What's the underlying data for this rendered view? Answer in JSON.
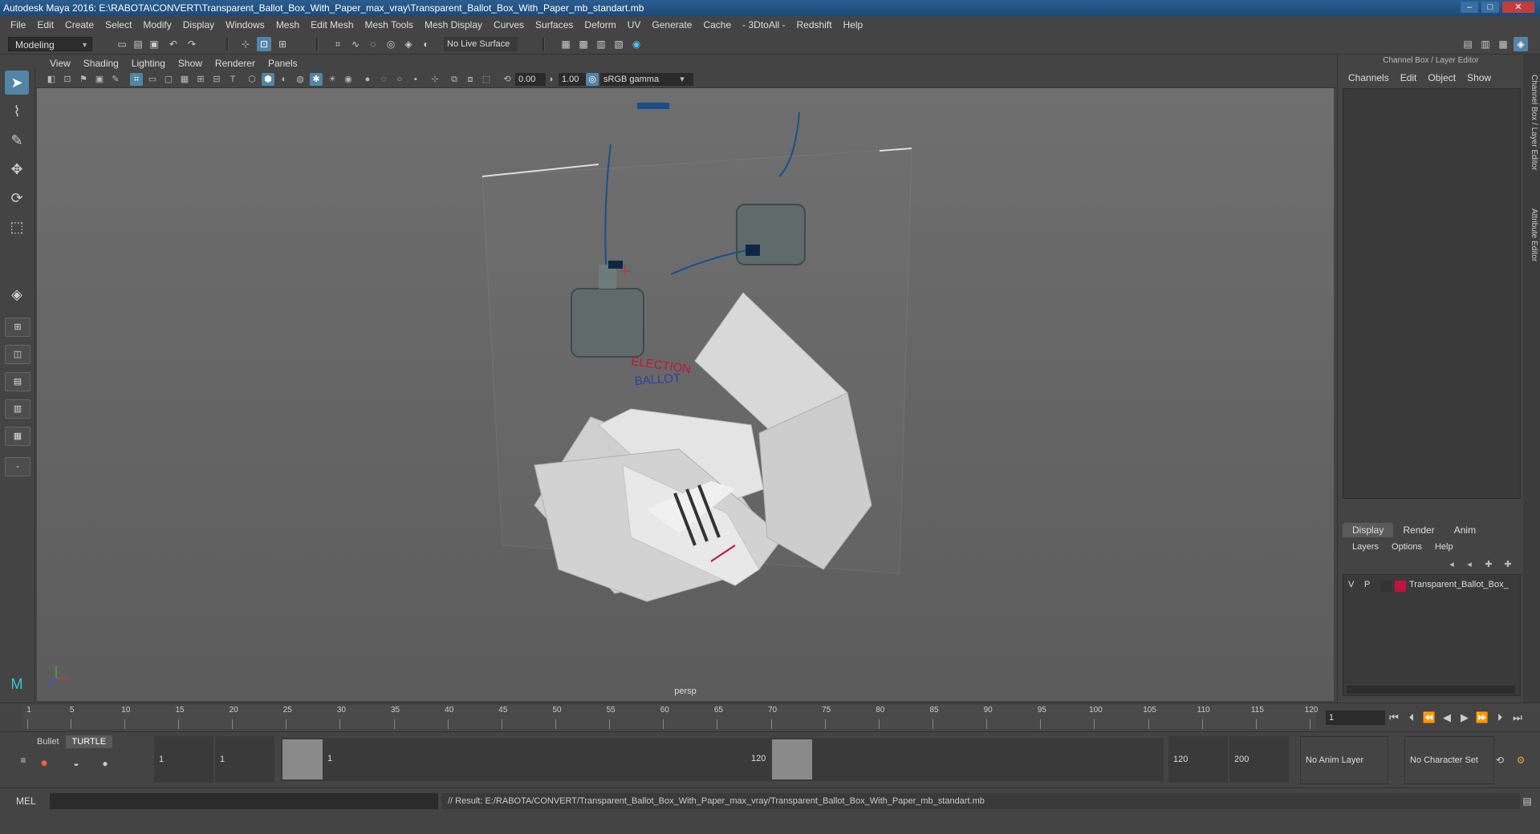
{
  "window": {
    "title": "Autodesk Maya 2016: E:\\RABOTA\\CONVERT\\Transparent_Ballot_Box_With_Paper_max_vray\\Transparent_Ballot_Box_With_Paper_mb_standart.mb"
  },
  "menu": [
    "File",
    "Edit",
    "Create",
    "Select",
    "Modify",
    "Display",
    "Windows",
    "Mesh",
    "Edit Mesh",
    "Mesh Tools",
    "Mesh Display",
    "Curves",
    "Surfaces",
    "Deform",
    "UV",
    "Generate",
    "Cache",
    "- 3DtoAll -",
    "Redshift",
    "Help"
  ],
  "toolbar": {
    "workspace": "Modeling",
    "live_surface": "No Live Surface"
  },
  "viewport_menu": [
    "View",
    "Shading",
    "Lighting",
    "Show",
    "Renderer",
    "Panels"
  ],
  "viewport_fields": {
    "exposure": "0.00",
    "gamma": "1.00",
    "color_space": "sRGB gamma"
  },
  "viewport": {
    "camera": "persp",
    "ballot_text1": "ELECTION",
    "ballot_text2": "BALLOT"
  },
  "channel_box": {
    "title": "Channel Box / Layer Editor",
    "menu": [
      "Channels",
      "Edit",
      "Object",
      "Show"
    ],
    "tabs": [
      "Display",
      "Render",
      "Anim"
    ],
    "layer_menu": [
      "Layers",
      "Options",
      "Help"
    ],
    "layer": {
      "v": "V",
      "p": "P",
      "name": "Transparent_Ballot_Box_",
      "color": "#c0143c"
    }
  },
  "side_tabs": [
    "Channel Box / Layer Editor",
    "Attribute Editor"
  ],
  "timeline": {
    "ticks": [
      "1",
      "5",
      "10",
      "15",
      "20",
      "25",
      "30",
      "35",
      "40",
      "45",
      "50",
      "55",
      "60",
      "65",
      "70",
      "75",
      "80",
      "85",
      "90",
      "95",
      "100",
      "105",
      "110",
      "115",
      "120"
    ],
    "current_frame": "1"
  },
  "range": {
    "shelf_tabs": [
      "Bullet",
      "TURTLE"
    ],
    "start": "1",
    "playback_start": "1",
    "slider_start": "1",
    "slider_end": "120",
    "playback_end": "120",
    "end": "200",
    "anim_layer": "No Anim Layer",
    "character_set": "No Character Set"
  },
  "command": {
    "mel": "MEL",
    "result": "// Result: E:/RABOTA/CONVERT/Transparent_Ballot_Box_With_Paper_max_vray/Transparent_Ballot_Box_With_Paper_mb_standart.mb"
  },
  "colors": {
    "accent": "#5285a6",
    "title_bar": "#1d4a78"
  }
}
